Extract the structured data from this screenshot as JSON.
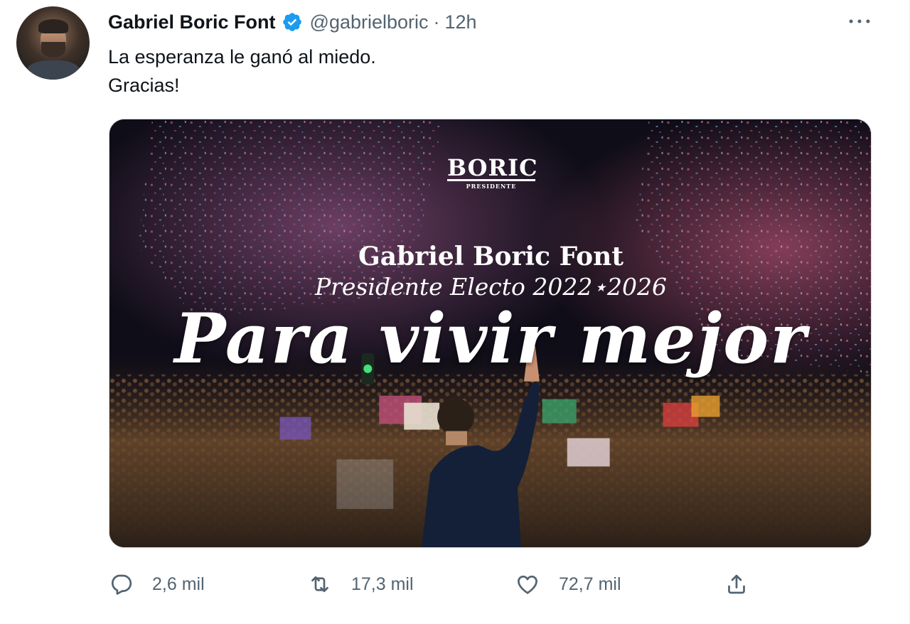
{
  "tweet": {
    "author_name": "Gabriel Boric Font",
    "handle": "@gabrielboric",
    "separator": "·",
    "time": "12h",
    "text_lines": [
      "La esperanza le ganó al miedo.",
      "Gracias!"
    ]
  },
  "media": {
    "logo_word": "BORIC",
    "logo_sub": "PRESIDENTE",
    "headline": "Gabriel Boric Font",
    "subline": "Presidente Electo 2022⋆2026",
    "slogan": "Para vivir mejor"
  },
  "actions": {
    "reply_count": "2,6 mil",
    "retweet_count": "17,3 mil",
    "like_count": "72,7 mil"
  },
  "icons": {
    "verified": "verified-badge-icon",
    "more": "more-options-icon",
    "reply": "reply-icon",
    "retweet": "retweet-icon",
    "like": "like-icon",
    "share": "share-icon"
  },
  "colors": {
    "verified_blue": "#1d9bf0",
    "text_primary": "#0f1419",
    "text_secondary": "#536471"
  }
}
